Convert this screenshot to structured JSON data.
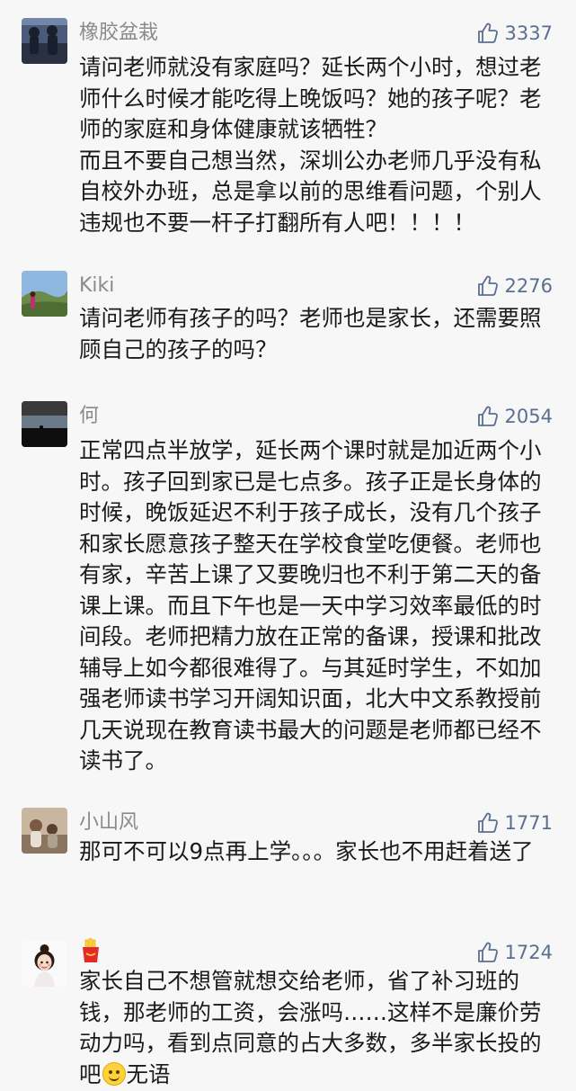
{
  "comments": [
    {
      "username": "橡胶盆栽",
      "likes": "3337",
      "text": "请问老师就没有家庭吗？延长两个小时，想过老师什么时候才能吃得上晚饭吗？她的孩子呢？老师的家庭和身体健康就该牺牲？\n而且不要自己想当然，深圳公办老师几乎没有私自校外办班，总是拿以前的思维看问题，个别人违规也不要一杆子打翻所有人吧！！！！",
      "avatar_icon": "photo-avatar-icon"
    },
    {
      "username": "Kiki",
      "likes": "2276",
      "text": "请问老师有孩子的吗？老师也是家长，还需要照顾自己的孩子的吗？",
      "avatar_icon": "landscape-avatar-icon"
    },
    {
      "username": "何",
      "likes": "2054",
      "text": "正常四点半放学，延长两个课时就是加近两个小时。孩子回到家已是七点多。孩子正是长身体的时候，晚饭延迟不利于孩子成长，没有几个孩子和家长愿意孩子整天在学校食堂吃便餐。老师也有家，辛苦上课了又要晚归也不利于第二天的备课上课。而且下午也是一天中学习效率最低的时间段。老师把精力放在正常的备课，授课和批改辅导上如今都很难得了。与其延时学生，不如加强老师读书学习开阔知识面，北大中文系教授前几天说现在教育读书最大的问题是老师都已经不读书了。",
      "avatar_icon": "dark-sea-avatar-icon"
    },
    {
      "username": "小山风",
      "likes": "1771",
      "text": "那可不可以9点再上学。。。家长也不用赶着送了",
      "avatar_icon": "family-photo-avatar-icon"
    },
    {
      "username": "",
      "likes": "1724",
      "text": "家长自己不想管就想交给老师，省了补习班的钱，那老师的工资，会涨吗……这样不是廉价劳动力吗，看到点同意的占大多数，多半家长投的吧",
      "text_suffix": "无语",
      "username_icon": "fries-emoji-icon",
      "inline_emoji": "smiling-face-emoji-icon",
      "avatar_icon": "girl-cartoon-avatar-icon"
    }
  ],
  "like_icon": "thumbs-up-icon",
  "colors": {
    "background": "#f7f7f7",
    "username": "#8a8a8a",
    "likes": "#5a6f8f",
    "text": "#1a1a1a"
  }
}
